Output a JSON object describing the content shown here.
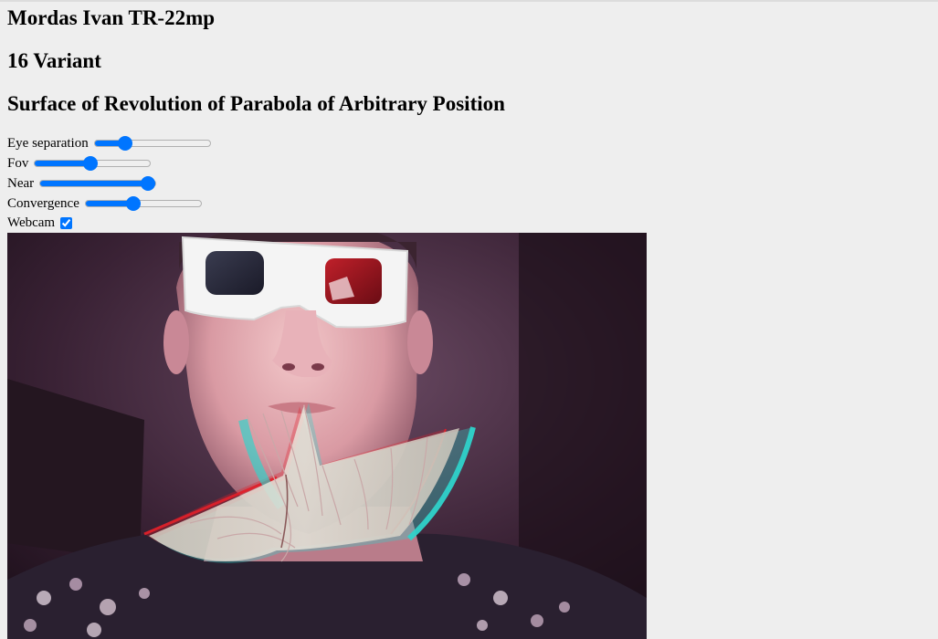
{
  "header": {
    "author": "Mordas Ivan TR-22mp",
    "variant": "16 Variant",
    "title": "Surface of Revolution of Parabola of Arbitrary Position"
  },
  "controls": {
    "eye_separation": {
      "label": "Eye separation",
      "value": 23
    },
    "fov": {
      "label": "Fov",
      "value": 48
    },
    "near": {
      "label": "Near",
      "value": 100
    },
    "convergence": {
      "label": "Convergence",
      "value": 40
    },
    "webcam": {
      "label": "Webcam",
      "checked": true
    }
  },
  "colors": {
    "accent": "#0075ff",
    "background": "#eeeeee",
    "anaglyph_red": "#e0202a",
    "anaglyph_cyan": "#2fd4cc"
  },
  "icons": {
    "webcam_checkbox": "checkbox-checked-icon"
  }
}
